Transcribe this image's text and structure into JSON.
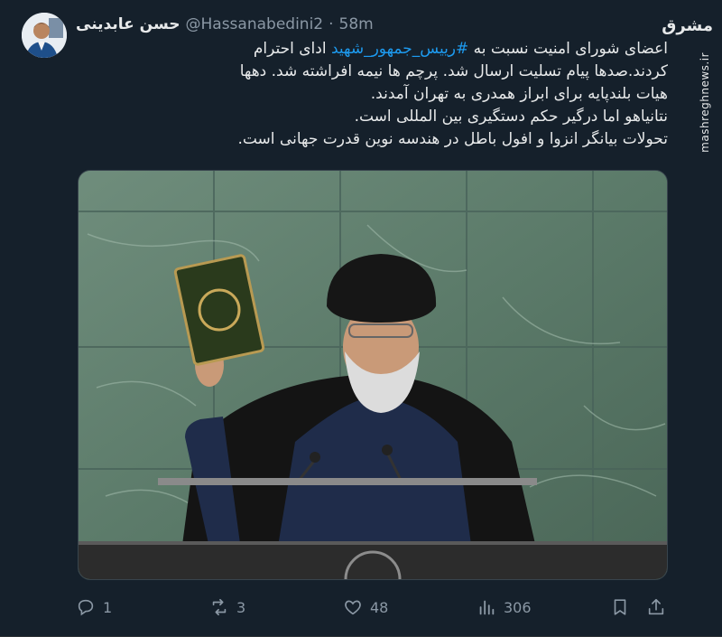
{
  "tweet": {
    "author_name": "حسن عابدینی",
    "handle": "@Hassanabedini2",
    "separator": "·",
    "time": "58m",
    "text": {
      "line1_pre": "اعضای شورای امنیت نسبت به ",
      "hashtag": "#رییس_جمهور_شهید",
      "line1_post": " ادای احترام کردند.صدها پیام تسلیت ارسال شد. پرچم ها نیمه افراشته شد. دهها هیات بلندپایه برای ابراز همدری به تهران آمدند.",
      "line2": "نتانیاهو اما درگیر حکم دستگیری بین المللی است.",
      "line3": "تحولات بیانگر انزوا و افول باطل در هندسه نوین قدرت جهانی است."
    }
  },
  "actions": {
    "reply_count": "1",
    "retweet_count": "3",
    "like_count": "48",
    "views_count": "306"
  },
  "watermark": {
    "logo": "مشرق",
    "text": "mashreghnews.ir"
  },
  "icons": {
    "reply": "reply-icon",
    "retweet": "retweet-icon",
    "like": "heart-icon",
    "views": "views-icon",
    "bookmark": "bookmark-icon",
    "share": "share-icon"
  },
  "colors": {
    "background": "#15202b",
    "text": "#e7e9ea",
    "muted": "#8b98a5",
    "hashtag": "#1d9bf0"
  }
}
